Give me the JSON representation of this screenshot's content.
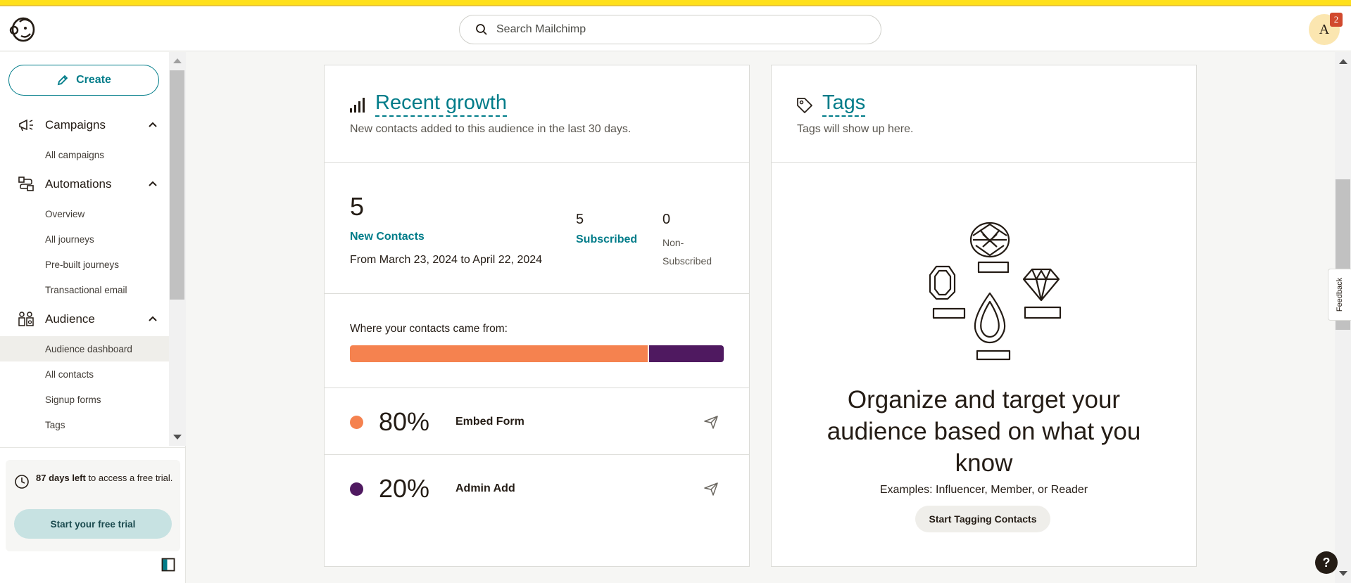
{
  "header": {
    "search_placeholder": "Search Mailchimp",
    "avatar_letter": "A",
    "notification_count": "2"
  },
  "sidebar": {
    "create_label": "Create",
    "sections": [
      {
        "label": "Campaigns",
        "icon": "megaphone-icon"
      },
      {
        "label": "Automations",
        "icon": "workflow-icon"
      },
      {
        "label": "Audience",
        "icon": "audience-icon"
      }
    ],
    "items": {
      "all_campaigns": "All campaigns",
      "overview": "Overview",
      "all_journeys": "All journeys",
      "prebuilt_journeys": "Pre-built journeys",
      "transactional_email": "Transactional email",
      "audience_dashboard": "Audience dashboard",
      "all_contacts": "All contacts",
      "signup_forms": "Signup forms",
      "tags": "Tags"
    },
    "trial": {
      "days_bold": "87 days left",
      "rest": " to access a free trial.",
      "button": "Start your free trial"
    }
  },
  "growth": {
    "title": "Recent growth",
    "subtitle": "New contacts added to this audience in the last 30 days.",
    "new_count": "5",
    "new_label": "New Contacts",
    "date_range": "From March 23, 2024 to April 22, 2024",
    "subscribed_count": "5",
    "subscribed_label": "Subscribed",
    "non_subscribed_count": "0",
    "non_subscribed_label": "Non-Subscribed",
    "sources_label": "Where your contacts came from:",
    "sources": [
      {
        "percent": "80%",
        "share": 0.8,
        "name": "Embed Form",
        "color": "#f5824f"
      },
      {
        "percent": "20%",
        "share": 0.2,
        "name": "Admin Add",
        "color": "#4f1960"
      }
    ]
  },
  "tags": {
    "title": "Tags",
    "subtitle": "Tags will show up here.",
    "headline": "Organize and target your audience based on what you know",
    "examples": "Examples: Influencer, Member, or Reader",
    "button": "Start Tagging Contacts"
  },
  "misc": {
    "feedback": "Feedback",
    "help": "?"
  },
  "colors": {
    "accent": "#007c89",
    "brand_yellow": "#ffe01b"
  }
}
